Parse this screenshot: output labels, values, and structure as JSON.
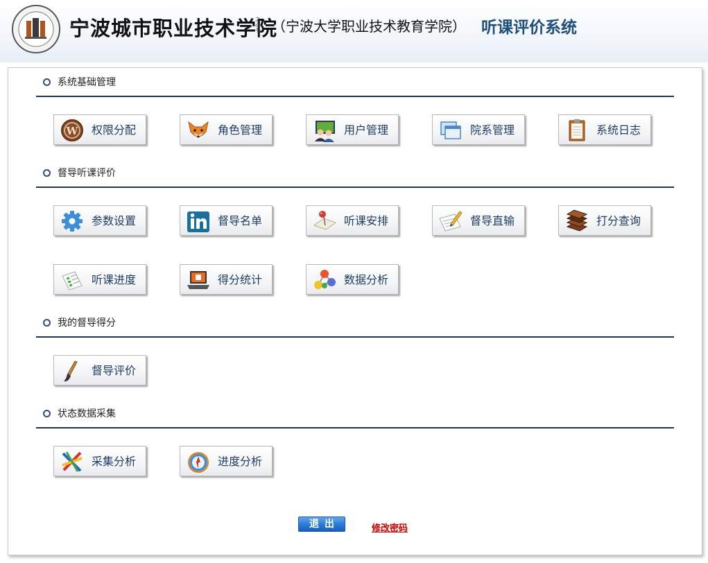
{
  "header": {
    "school_name": "宁波城市职业技术学院",
    "school_sub": "（宁波大学职业技术教育学院）",
    "system_title": "听课评价系统",
    "logo_icon": "college-emblem"
  },
  "sections": [
    {
      "title": "系统基础管理",
      "tiles": [
        {
          "label": "权限分配",
          "icon": "wordpress-icon"
        },
        {
          "label": "角色管理",
          "icon": "fox-icon"
        },
        {
          "label": "用户管理",
          "icon": "users-monitor-icon"
        },
        {
          "label": "院系管理",
          "icon": "windows-icon"
        },
        {
          "label": "系统日志",
          "icon": "clipboard-icon"
        }
      ]
    },
    {
      "title": "督导听课评价",
      "tiles": [
        {
          "label": "参数设置",
          "icon": "gear-icon"
        },
        {
          "label": "督导名单",
          "icon": "linkedin-icon"
        },
        {
          "label": "听课安排",
          "icon": "pushpin-icon"
        },
        {
          "label": "督导直输",
          "icon": "pencil-note-icon"
        },
        {
          "label": "打分查询",
          "icon": "books-icon"
        },
        {
          "label": "听课进度",
          "icon": "document-list-icon"
        },
        {
          "label": "得分统计",
          "icon": "laptop-icon"
        },
        {
          "label": "数据分析",
          "icon": "molecule-icon"
        }
      ]
    },
    {
      "title": "我的督导得分",
      "tiles": [
        {
          "label": "督导评价",
          "icon": "paintbrush-icon"
        }
      ]
    },
    {
      "title": "状态数据采集",
      "tiles": [
        {
          "label": "采集分析",
          "icon": "pencils-icon"
        },
        {
          "label": "进度分析",
          "icon": "compass-icon"
        }
      ]
    }
  ],
  "footer": {
    "exit_label": "退出",
    "change_password_label": "修改密码"
  },
  "colors": {
    "title_blue": "#1f4e7a",
    "tile_text": "#1f3c66",
    "section_line": "#1f3550",
    "link_red": "#cc0000",
    "button_blue": "#2b78d6"
  }
}
